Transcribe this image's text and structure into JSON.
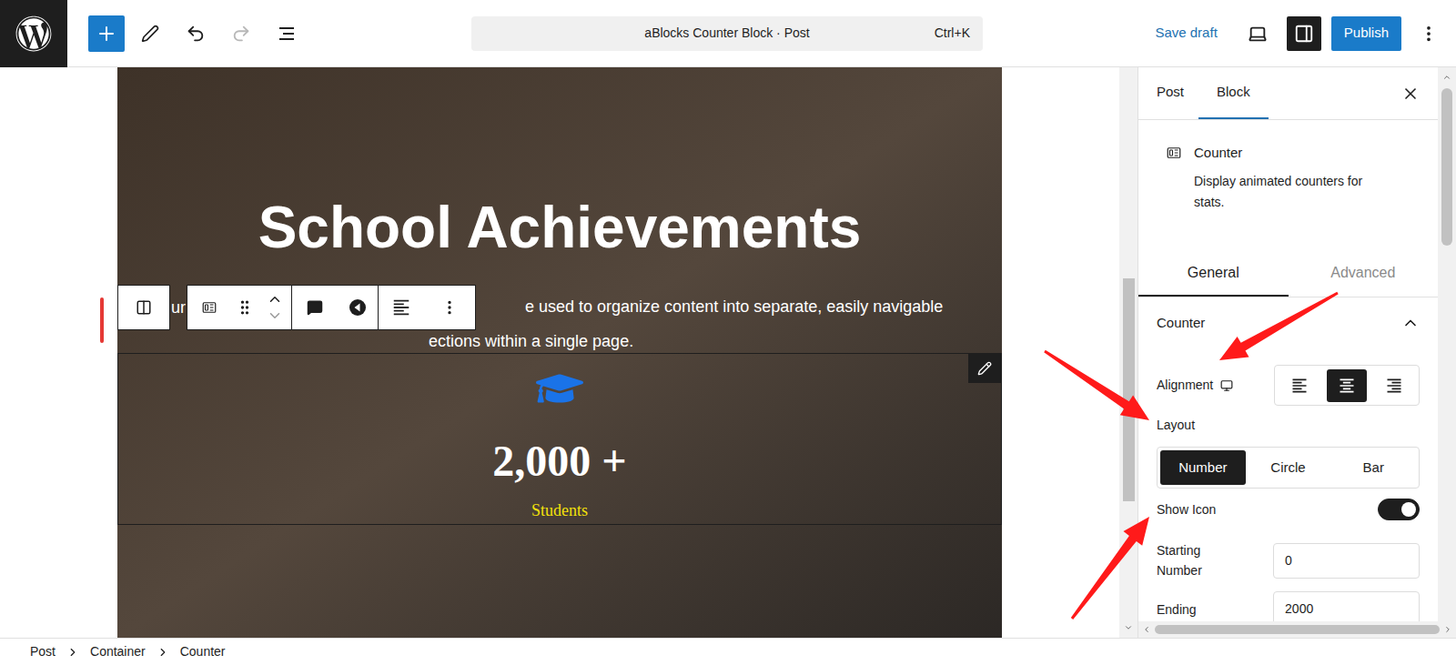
{
  "topbar": {
    "redo": {
      "disabled": true
    },
    "command": {
      "title": "aBlocks Counter Block · Post",
      "shortcut": "Ctrl+K"
    },
    "save_draft": "Save draft",
    "settings_toggle": {
      "on": true
    },
    "publish": "Publish"
  },
  "canvas": {
    "heading": "School Achievements",
    "paragraph": {
      "fragment": "ur",
      "line1": "e used to organize content into separate, easily navigable",
      "line2": "ections within a single page."
    },
    "counter": {
      "number": "2,000 +",
      "label": "Students"
    }
  },
  "sidebar": {
    "tabs": [
      {
        "label": "Post",
        "selected": false
      },
      {
        "label": "Block",
        "selected": true
      }
    ],
    "block": {
      "name": "Counter",
      "description": "Display animated counters for stats."
    },
    "subtabs": [
      {
        "label": "General",
        "selected": true
      },
      {
        "label": "Advanced",
        "selected": false
      }
    ],
    "panel": {
      "title": "Counter",
      "expanded": true
    },
    "alignment": {
      "label": "Alignment",
      "options": [
        {
          "selected": false
        },
        {
          "selected": true
        },
        {
          "selected": false
        }
      ]
    },
    "layout": {
      "label": "Layout",
      "options": [
        {
          "label": "Number",
          "selected": true
        },
        {
          "label": "Circle",
          "selected": false
        },
        {
          "label": "Bar",
          "selected": false
        }
      ]
    },
    "show_icon": {
      "label": "Show Icon",
      "on": true
    },
    "fields": [
      {
        "label": "Starting Number",
        "value": "0"
      },
      {
        "label": "Ending",
        "value": "2000"
      }
    ]
  },
  "breadcrumbs": [
    "Post",
    "Container",
    "Counter"
  ]
}
